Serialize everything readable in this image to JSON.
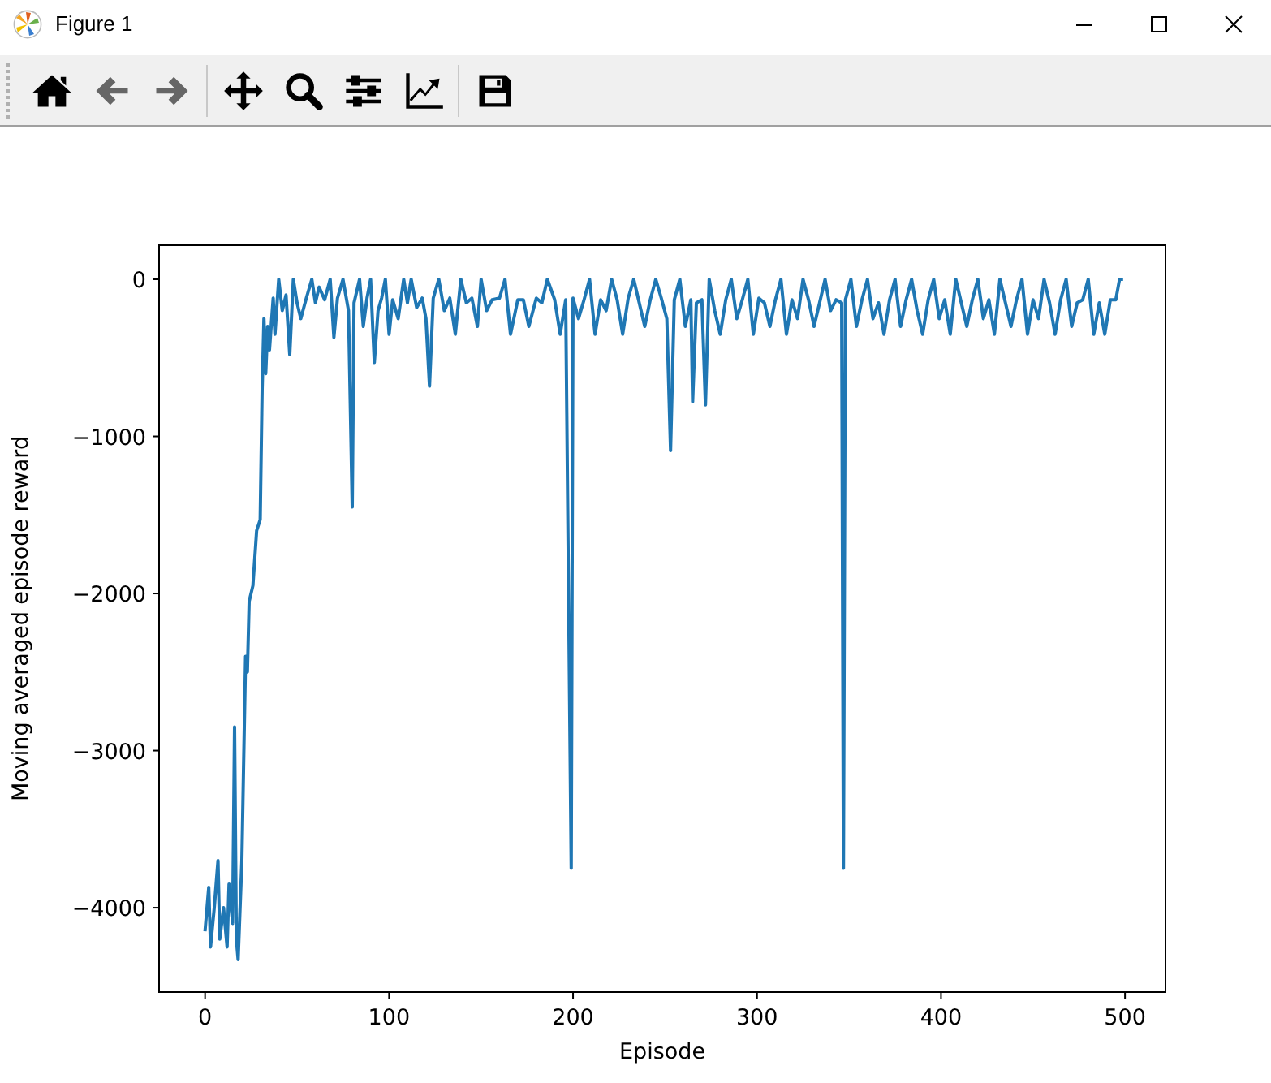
{
  "window": {
    "title": "Figure 1"
  },
  "toolbar": {
    "groups": [
      [
        {
          "kind": "home",
          "disabled": false
        },
        {
          "kind": "back",
          "disabled": true
        },
        {
          "kind": "forward",
          "disabled": true
        }
      ],
      [
        {
          "kind": "pan",
          "disabled": false
        },
        {
          "kind": "zoom",
          "disabled": false
        },
        {
          "kind": "subplots",
          "disabled": false
        },
        {
          "kind": "customize",
          "disabled": false
        }
      ],
      [
        {
          "kind": "save",
          "disabled": false
        }
      ]
    ]
  },
  "chart_data": {
    "type": "line",
    "xlabel": "Episode",
    "ylabel": "Moving averaged episode reward",
    "xlim": [
      -25,
      522
    ],
    "ylim": [
      -4537,
      217
    ],
    "xticks": [
      0,
      100,
      200,
      300,
      400,
      500
    ],
    "yticks": [
      {
        "value": -4000,
        "label": "−4000"
      },
      {
        "value": -3000,
        "label": "−3000"
      },
      {
        "value": -2000,
        "label": "−2000"
      },
      {
        "value": -1000,
        "label": "−1000"
      },
      {
        "value": 0,
        "label": "0"
      }
    ],
    "x": [
      0,
      2,
      3,
      5,
      7,
      8,
      10,
      12,
      13,
      15,
      16,
      17,
      18,
      20,
      22,
      23,
      24,
      26,
      28,
      30,
      31,
      32,
      33,
      34,
      35,
      37,
      38,
      40,
      42,
      44,
      46,
      48,
      50,
      52,
      55,
      58,
      60,
      62,
      65,
      68,
      70,
      72,
      75,
      78,
      80,
      81,
      84,
      86,
      88,
      90,
      92,
      94,
      96,
      98,
      100,
      102,
      105,
      108,
      110,
      112,
      115,
      118,
      120,
      122,
      124,
      127,
      130,
      133,
      136,
      139,
      142,
      145,
      148,
      150,
      153,
      156,
      160,
      163,
      166,
      170,
      173,
      176,
      180,
      183,
      186,
      190,
      193,
      196,
      199,
      200,
      203,
      206,
      209,
      212,
      215,
      218,
      221,
      224,
      227,
      230,
      233,
      236,
      239,
      242,
      245,
      248,
      251,
      253,
      255,
      258,
      261,
      264,
      265,
      267,
      270,
      272,
      274,
      277,
      280,
      283,
      286,
      289,
      292,
      295,
      298,
      301,
      304,
      307,
      310,
      313,
      316,
      319,
      322,
      325,
      328,
      331,
      334,
      337,
      340,
      343,
      346,
      347,
      348,
      351,
      354,
      357,
      360,
      363,
      366,
      369,
      372,
      375,
      378,
      381,
      384,
      387,
      390,
      393,
      396,
      399,
      402,
      405,
      408,
      411,
      414,
      417,
      420,
      423,
      426,
      429,
      432,
      435,
      438,
      441,
      444,
      447,
      450,
      453,
      456,
      459,
      462,
      465,
      468,
      471,
      474,
      477,
      480,
      483,
      486,
      489,
      492,
      495,
      497,
      499
    ],
    "series": [
      {
        "color": "#1f77b4",
        "values": [
          -4150,
          -3870,
          -4250,
          -4000,
          -3700,
          -4200,
          -4000,
          -4250,
          -3850,
          -4100,
          -2850,
          -4200,
          -4330,
          -3700,
          -2400,
          -2500,
          -2050,
          -1950,
          -1600,
          -1530,
          -700,
          -250,
          -600,
          -300,
          -450,
          -120,
          -350,
          0,
          -200,
          -100,
          -480,
          0,
          -150,
          -250,
          -120,
          0,
          -150,
          -50,
          -130,
          0,
          -370,
          -120,
          0,
          -200,
          -1450,
          -150,
          0,
          -300,
          -120,
          0,
          -530,
          -200,
          -120,
          0,
          -350,
          -130,
          -250,
          0,
          -150,
          0,
          -180,
          -120,
          -250,
          -680,
          -120,
          0,
          -200,
          -120,
          -350,
          0,
          -150,
          -120,
          -300,
          0,
          -200,
          -130,
          -120,
          0,
          -350,
          -130,
          -130,
          -300,
          -120,
          -150,
          0,
          -130,
          -350,
          -130,
          -3750,
          -120,
          -250,
          -130,
          0,
          -350,
          -130,
          -200,
          0,
          -130,
          -350,
          -120,
          0,
          -150,
          -300,
          -130,
          0,
          -120,
          -250,
          -1090,
          -130,
          0,
          -300,
          -130,
          -780,
          -150,
          -130,
          -800,
          0,
          -200,
          -350,
          -130,
          0,
          -250,
          -130,
          0,
          -350,
          -120,
          -150,
          -300,
          -130,
          0,
          -350,
          -130,
          -250,
          0,
          -130,
          -300,
          -150,
          0,
          -200,
          -130,
          -150,
          -3750,
          -130,
          0,
          -300,
          -130,
          0,
          -250,
          -150,
          -350,
          -130,
          0,
          -300,
          -130,
          0,
          -200,
          -350,
          -130,
          0,
          -250,
          -130,
          -350,
          0,
          -150,
          -300,
          -130,
          0,
          -250,
          -130,
          -350,
          0,
          -150,
          -300,
          -130,
          0,
          -350,
          -130,
          -250,
          0,
          -150,
          -350,
          -130,
          0,
          -300,
          -150,
          -130,
          0,
          -350,
          -150,
          -350,
          -130,
          -130,
          0,
          0
        ]
      }
    ]
  }
}
